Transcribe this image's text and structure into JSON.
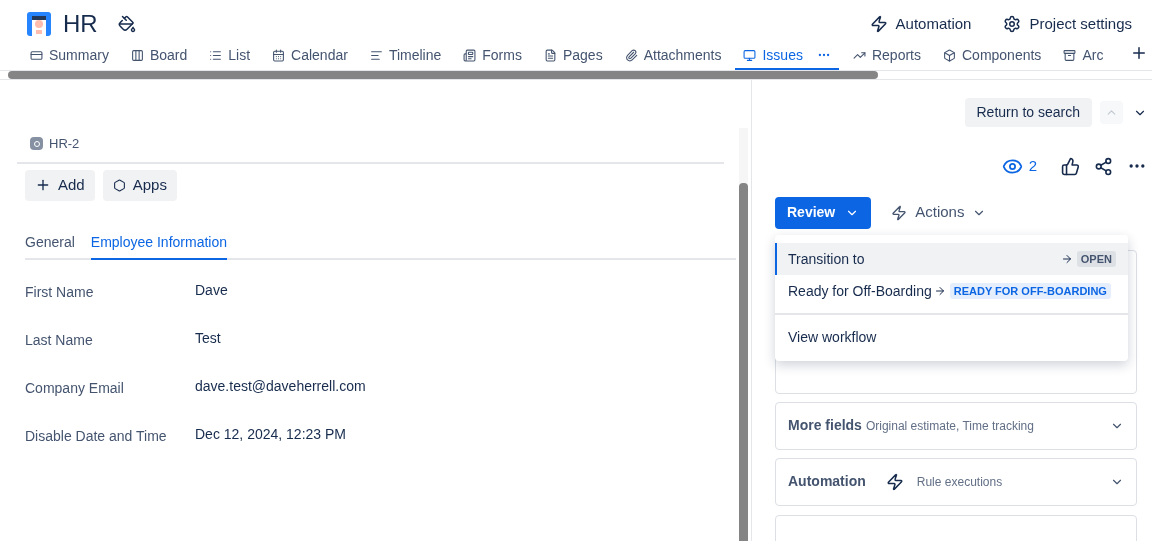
{
  "project": {
    "name": "HR"
  },
  "header_actions": [
    {
      "label": "Automation"
    },
    {
      "label": "Project settings"
    }
  ],
  "nav_tabs": [
    {
      "label": "Summary",
      "selected": false
    },
    {
      "label": "Board",
      "selected": false
    },
    {
      "label": "List",
      "selected": false
    },
    {
      "label": "Calendar",
      "selected": false
    },
    {
      "label": "Timeline",
      "selected": false
    },
    {
      "label": "Forms",
      "selected": false
    },
    {
      "label": "Pages",
      "selected": false
    },
    {
      "label": "Attachments",
      "selected": false
    },
    {
      "label": "Issues",
      "selected": true
    },
    {
      "label": "Reports",
      "selected": false
    },
    {
      "label": "Components",
      "selected": false
    },
    {
      "label": "Arc",
      "selected": false
    }
  ],
  "return_button": {
    "label": "Return to search"
  },
  "issue": {
    "key": "HR-2",
    "buttons": [
      {
        "label": "Add"
      },
      {
        "label": "Apps"
      }
    ],
    "tabs": [
      {
        "label": "General",
        "selected": false
      },
      {
        "label": "Employee Information",
        "selected": true
      }
    ],
    "fields": [
      {
        "label": "First Name",
        "value": "Dave"
      },
      {
        "label": "Last Name",
        "value": "Test"
      },
      {
        "label": "Company Email",
        "value": "dave.test@daveherrell.com"
      },
      {
        "label": "Disable Date and Time",
        "value": "Dec 12, 2024, 12:23 PM"
      }
    ]
  },
  "side": {
    "watchers": "2",
    "status_button": {
      "label": "Review",
      "expanded": true
    },
    "actions_button": {
      "label": "Actions"
    },
    "menu": [
      {
        "kind": "transition",
        "label": "Transition to",
        "selected": true,
        "status": {
          "text": "OPEN",
          "color": "#44546f"
        }
      },
      {
        "kind": "transition",
        "label": "Ready for Off-Boarding",
        "selected": false,
        "status": {
          "text": "READY FOR OFF-BOARDING",
          "color": "#0c66e4"
        }
      },
      {
        "kind": "link",
        "label": "View workflow",
        "selected": false
      }
    ],
    "panels": [
      {
        "title": "More fields",
        "subtitle": "Original estimate, Time tracking"
      },
      {
        "title": "Automation",
        "subtitle": "Rule executions",
        "kind": "automation"
      }
    ]
  }
}
